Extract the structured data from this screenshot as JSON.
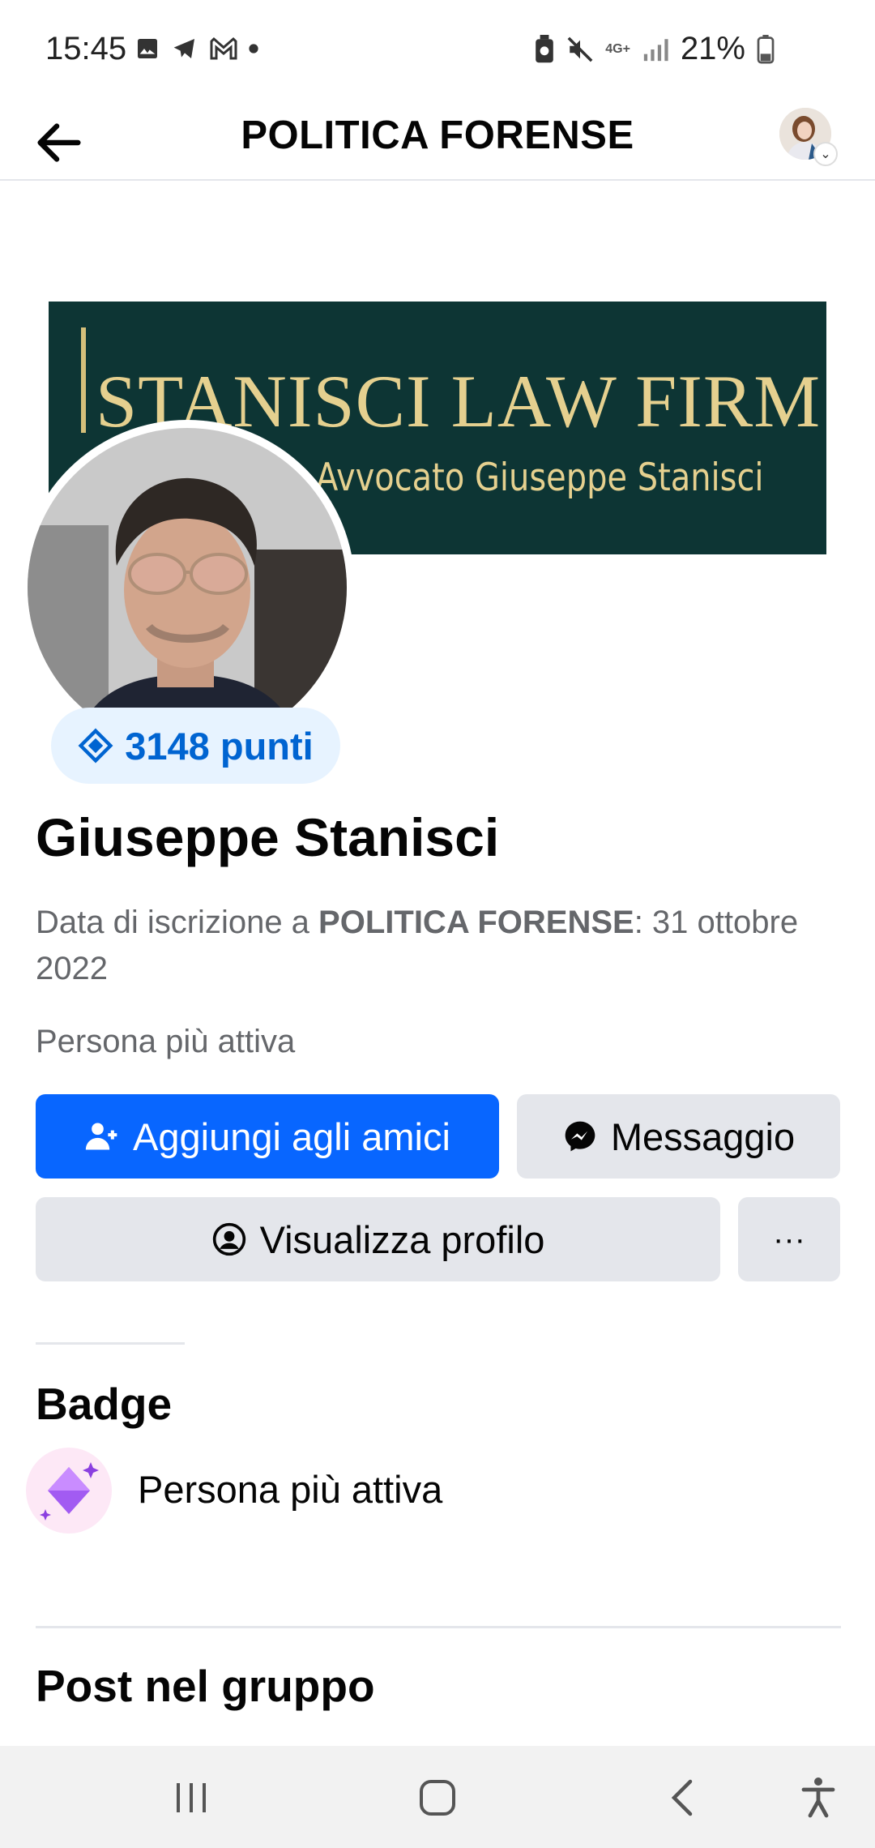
{
  "status_bar": {
    "time": "15:45",
    "battery": "21%",
    "network": "4G+",
    "icons": [
      "gallery-icon",
      "telegram-icon",
      "gmail-icon",
      "dot-icon",
      "battery-saver-icon",
      "mute-icon",
      "network-icon",
      "signal-icon",
      "battery-icon"
    ]
  },
  "header": {
    "title": "POLITICA FORENSE"
  },
  "cover": {
    "title": "STANISCI LAW FIRM",
    "subtitle": "Avvocato Giuseppe Stanisci",
    "background": "#0d3534",
    "text_color": "#e5d08f"
  },
  "profile": {
    "points": "3148 punti",
    "name": "Giuseppe Stanisci",
    "join_prefix": "Data di iscrizione a ",
    "join_group": "POLITICA FORENSE",
    "join_suffix": ": 31 ottobre 2022",
    "status": "Persona più attiva"
  },
  "actions": {
    "add_friend": "Aggiungi agli amici",
    "message": "Messaggio",
    "view_profile": "Visualizza profilo",
    "more": "···"
  },
  "badges": {
    "heading": "Badge",
    "items": [
      {
        "label": "Persona più attiva",
        "icon": "sparkle-diamond-icon"
      }
    ]
  },
  "posts": {
    "heading": "Post nel gruppo"
  },
  "colors": {
    "primary": "#0866ff",
    "secondary_button": "#e4e6eb",
    "points_text": "#0064d1",
    "points_bg": "#e7f3ff",
    "muted_text": "#65676b"
  }
}
